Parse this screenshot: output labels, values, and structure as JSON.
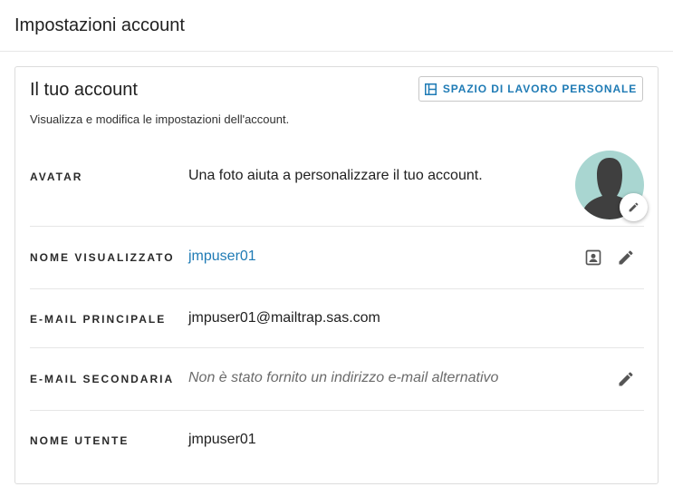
{
  "page": {
    "title": "Impostazioni account"
  },
  "account": {
    "title": "Il tuo account",
    "description": "Visualizza e modifica le impostazioni dell'account.",
    "workspace_button": {
      "label": "SPAZIO DI LAVORO PERSONALE",
      "icon": "layout-icon"
    }
  },
  "rows": {
    "avatar": {
      "label": "AVATAR",
      "value": "Una foto aiuta a personalizzare il tuo account."
    },
    "display_name": {
      "label": "NOME VISUALIZZATO",
      "value": "jmpuser01"
    },
    "primary_email": {
      "label": "E-MAIL PRINCIPALE",
      "value": "jmpuser01@mailtrap.sas.com"
    },
    "secondary_email": {
      "label": "E-MAIL SECONDARIA",
      "value": "Non è stato fornito un indirizzo e-mail alternativo"
    },
    "username": {
      "label": "NOME UTENTE",
      "value": "jmpuser01"
    }
  },
  "colors": {
    "accent": "#1f7bb5",
    "avatar_bg": "#a9d6d1",
    "avatar_silhouette": "#3f3f3f",
    "icon": "#555555"
  }
}
